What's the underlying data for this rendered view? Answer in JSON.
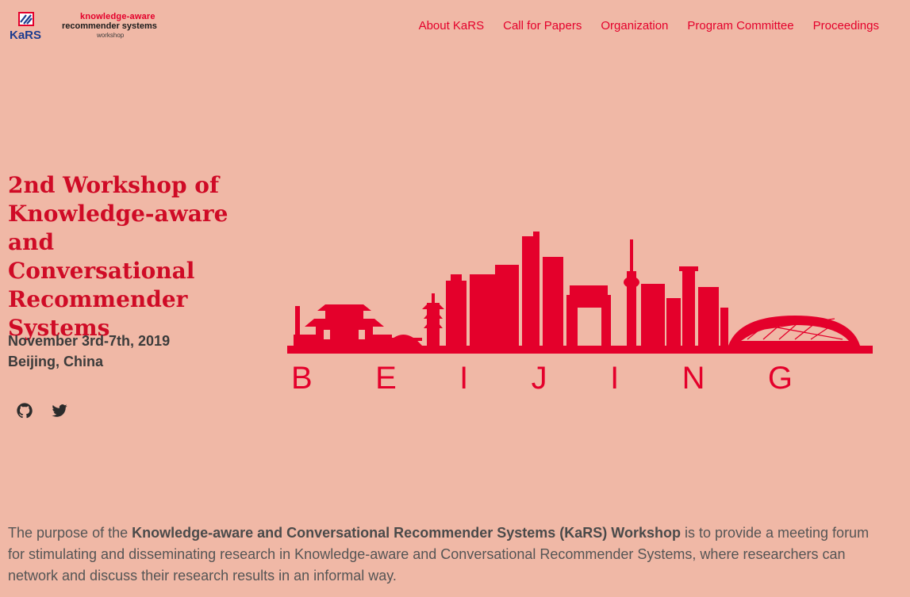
{
  "logo": {
    "mark_text": "KaRS",
    "line1": "knowledge-aware",
    "line2": "recommender systems",
    "line3": "workshop"
  },
  "nav": {
    "items": [
      {
        "label": "About KaRS"
      },
      {
        "label": "Call for Papers"
      },
      {
        "label": "Organization"
      },
      {
        "label": "Program Committee"
      },
      {
        "label": "Proceedings"
      }
    ]
  },
  "hero": {
    "title": "2nd Workshop of Knowledge-aware and Conversational Recommender Systems",
    "date": "November 3rd-7th, 2019",
    "location": "Beijing, China"
  },
  "social": {
    "github_icon": "github-icon",
    "twitter_icon": "twitter-icon"
  },
  "skyline": {
    "caption": "BEIJING",
    "letters": [
      "B",
      "E",
      "I",
      "J",
      "I",
      "N",
      "G"
    ]
  },
  "purpose": {
    "prefix": "The purpose of the ",
    "highlight": "Knowledge-aware and Conversational Recommender Systems (KaRS) Workshop",
    "suffix": " is to provide a meeting forum for stimulating and disseminating research in Knowledge-aware and Conversational Recommender Systems, where researchers can network and discuss their research results in an informal way."
  },
  "colors": {
    "background": "#f0b8a6",
    "accent": "#e4002b",
    "title": "#cf0b26",
    "text": "#3b3b3b"
  }
}
